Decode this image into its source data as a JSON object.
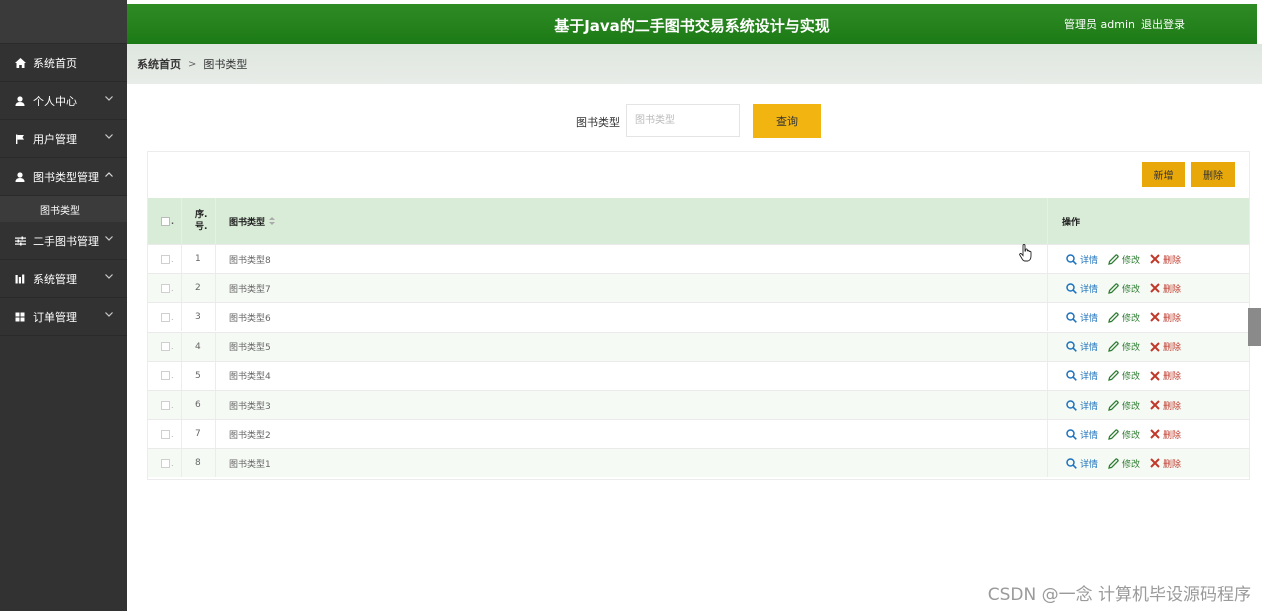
{
  "app": {
    "title": "基于Java的二手图书交易系统设计与实现",
    "user_label": "管理员 admin",
    "logout_label": "退出登录",
    "header_color": "#228b1e"
  },
  "sidebar": {
    "items": [
      {
        "label": "系统首页",
        "icon": "home-icon",
        "has_chevron": false
      },
      {
        "label": "个人中心",
        "icon": "user-icon",
        "has_chevron": true
      },
      {
        "label": "用户管理",
        "icon": "flag-icon",
        "has_chevron": true
      },
      {
        "label": "图书类型管理",
        "icon": "user-icon",
        "has_chevron": true,
        "expanded": true
      },
      {
        "label": "二手图书管理",
        "icon": "sliders-icon",
        "has_chevron": true
      },
      {
        "label": "系统管理",
        "icon": "chart-icon",
        "has_chevron": true
      },
      {
        "label": "订单管理",
        "icon": "grid-icon",
        "has_chevron": true
      }
    ],
    "sub_item": {
      "label": "图书类型"
    }
  },
  "breadcrumb": {
    "home": "系统首页",
    "separator": ">",
    "current": "图书类型"
  },
  "search": {
    "label": "图书类型",
    "placeholder": "图书类型",
    "button_label": "查询"
  },
  "toolbar": {
    "add_label": "新增",
    "delete_label": "删除"
  },
  "table": {
    "headers": {
      "index": "序.\n号.",
      "index_line1": "序.",
      "index_line2": "号.",
      "type": "图书类型",
      "actions": "操作"
    },
    "action_labels": {
      "detail": "详情",
      "edit": "修改",
      "delete": "删除"
    },
    "rows": [
      {
        "index": "1",
        "type": "图书类型8"
      },
      {
        "index": "2",
        "type": "图书类型7"
      },
      {
        "index": "3",
        "type": "图书类型6"
      },
      {
        "index": "4",
        "type": "图书类型5"
      },
      {
        "index": "5",
        "type": "图书类型4"
      },
      {
        "index": "6",
        "type": "图书类型3"
      },
      {
        "index": "7",
        "type": "图书类型2"
      },
      {
        "index": "8",
        "type": "图书类型1"
      }
    ]
  },
  "watermark": "CSDN @一念 计算机毕设源码程序"
}
